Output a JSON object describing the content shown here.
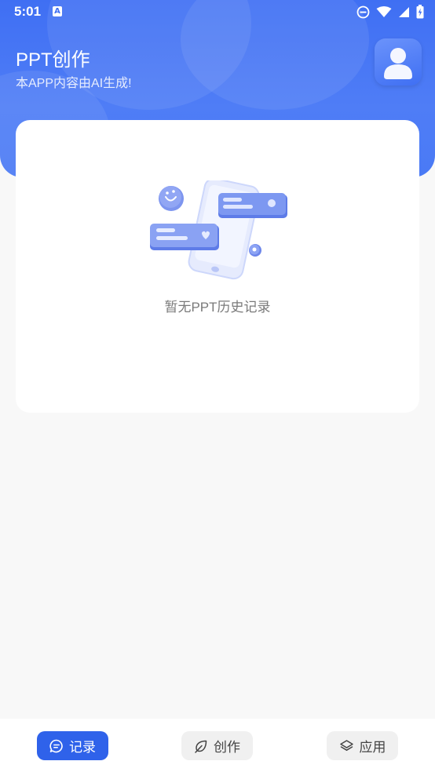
{
  "status_bar": {
    "time": "5:01",
    "notification_badge": "A"
  },
  "header": {
    "title": "PPT创作",
    "subtitle": "本APP内容由AI生成!"
  },
  "history": {
    "empty_text": "暂无PPT历史记录"
  },
  "tabbar": {
    "tabs": [
      {
        "label": "记录",
        "icon": "chat-bubble-icon",
        "active": true
      },
      {
        "label": "创作",
        "icon": "leaf-icon",
        "active": false
      },
      {
        "label": "应用",
        "icon": "layers-icon",
        "active": false
      }
    ]
  },
  "colors": {
    "accent": "#2f62ea",
    "header_gradient_top": "#3f6ff3",
    "background": "#f8f8f8"
  }
}
